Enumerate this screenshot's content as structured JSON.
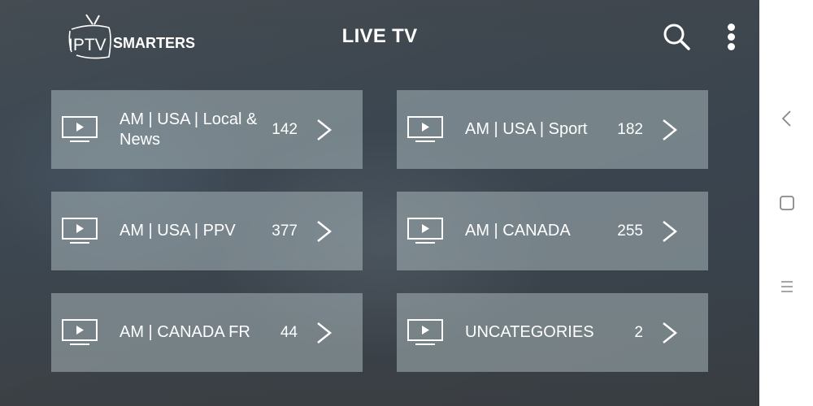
{
  "header": {
    "logo_left": "IPTV",
    "logo_right": "SMARTERS",
    "title": "LIVE TV",
    "search_icon": "search-icon",
    "more_icon": "more-vertical-icon"
  },
  "categories": [
    {
      "label": "AM | USA | Local & News",
      "count": "142",
      "icon": "tv-play-icon"
    },
    {
      "label": "AM | USA | Sport",
      "count": "182",
      "icon": "tv-play-icon"
    },
    {
      "label": "AM | USA | PPV",
      "count": "377",
      "icon": "tv-play-icon"
    },
    {
      "label": "AM | CANADA",
      "count": "255",
      "icon": "tv-play-icon"
    },
    {
      "label": "AM | CANADA FR",
      "count": "44",
      "icon": "tv-play-icon"
    },
    {
      "label": "UNCATEGORIES",
      "count": "2",
      "icon": "tv-play-icon"
    }
  ],
  "system_nav": {
    "back_icon": "back-icon",
    "home_icon": "home-icon",
    "recents_icon": "recents-icon"
  },
  "colors": {
    "background": "#3c4650",
    "card": "#8a9aa0",
    "text": "#ffffff",
    "nav_bar": "#ffffff",
    "nav_icon": "#888888"
  }
}
